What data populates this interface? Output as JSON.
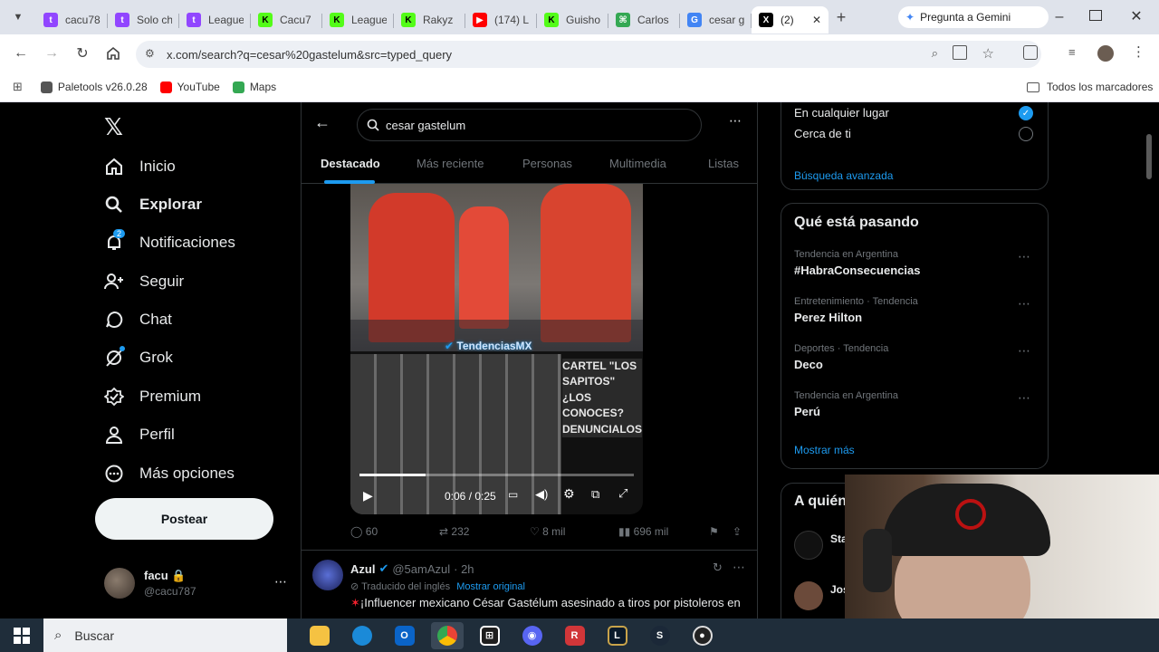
{
  "browser": {
    "tabs": [
      {
        "label": "cacu78",
        "color": "#9146ff",
        "glyph": "t"
      },
      {
        "label": "Solo ch",
        "color": "#9146ff",
        "glyph": "t"
      },
      {
        "label": "League",
        "color": "#9146ff",
        "glyph": "t"
      },
      {
        "label": "Cacu7",
        "color": "#53fc18",
        "glyph": "K"
      },
      {
        "label": "League",
        "color": "#53fc18",
        "glyph": "K"
      },
      {
        "label": "Rakyz",
        "color": "#53fc18",
        "glyph": "K"
      },
      {
        "label": "(174) L",
        "color": "#ff0000",
        "glyph": "▶"
      },
      {
        "label": "Guisho",
        "color": "#53fc18",
        "glyph": "K"
      },
      {
        "label": "Carlos",
        "color": "#34a853",
        "glyph": "⌘"
      },
      {
        "label": "cesar g",
        "color": "#4285f4",
        "glyph": "G"
      },
      {
        "label": "(2)",
        "color": "#000000",
        "glyph": "X"
      }
    ],
    "gemini_button": "Pregunta a Gemini",
    "url": "x.com/search?q=cesar%20gastelum&src=typed_query",
    "bookmarks": [
      {
        "label": "Paletools v26.0.28",
        "color": "#555555"
      },
      {
        "label": "YouTube",
        "color": "#ff0000"
      },
      {
        "label": "Maps",
        "color": "#34a853"
      }
    ],
    "all_bookmarks": "Todos los marcadores"
  },
  "nav": {
    "items": [
      {
        "label": "Inicio",
        "icon": "home-icon"
      },
      {
        "label": "Explorar",
        "icon": "search-icon"
      },
      {
        "label": "Notificaciones",
        "icon": "bell-icon",
        "badge": "2"
      },
      {
        "label": "Seguir",
        "icon": "follow-icon"
      },
      {
        "label": "Chat",
        "icon": "chat-icon"
      },
      {
        "label": "Grok",
        "icon": "grok-icon"
      },
      {
        "label": "Premium",
        "icon": "premium-icon"
      },
      {
        "label": "Perfil",
        "icon": "person-icon"
      },
      {
        "label": "Más opciones",
        "icon": "more-icon"
      }
    ],
    "post_button": "Postear",
    "user": {
      "name": "facu",
      "handle": "@cacu787"
    }
  },
  "search": {
    "query": "cesar gastelum",
    "tabs": [
      "Destacado",
      "Más reciente",
      "Personas",
      "Multimedia",
      "Listas"
    ],
    "active_tab": "Destacado"
  },
  "video": {
    "watermark": "TendenciasMX",
    "poster_caption": "CARTEL \"LOS SAPITOS\" ¿LOS CONOCES? DENUNCIALOS",
    "time": "0:06 / 0:25",
    "progress": 0.24
  },
  "post_stats": {
    "replies": "60",
    "reposts": "232",
    "likes": "8 mil",
    "views": "696 mil"
  },
  "next_post": {
    "name": "Azul",
    "handle": "@5amAzul",
    "age": "· 2h",
    "translated": "Traducido del inglés",
    "show_original": "Mostrar original",
    "text": "¡Influencer mexicano César Gastélum asesinado a tiros por pistoleros en"
  },
  "right": {
    "location_options": [
      "En cualquier lugar",
      "Cerca de ti"
    ],
    "advanced_search": "Búsqueda avanzada",
    "trends_title": "Qué está pasando",
    "trends": [
      {
        "meta": "Tendencia en Argentina",
        "title": "#HabraConsecuencias"
      },
      {
        "meta": "Entretenimiento · Tendencia",
        "title": "Perez Hilton"
      },
      {
        "meta": "Deportes · Tendencia",
        "title": "Deco"
      },
      {
        "meta": "Tendencia en Argentina",
        "title": "Perú"
      }
    ],
    "show_more": "Mostrar más",
    "who_to_follow": "A quién",
    "follow_names": [
      "Sta",
      "Jos"
    ]
  },
  "taskbar": {
    "search_placeholder": "Buscar"
  },
  "colors": {
    "accent": "#1d9bf0",
    "border": "#2f3336",
    "muted": "#71767b"
  }
}
